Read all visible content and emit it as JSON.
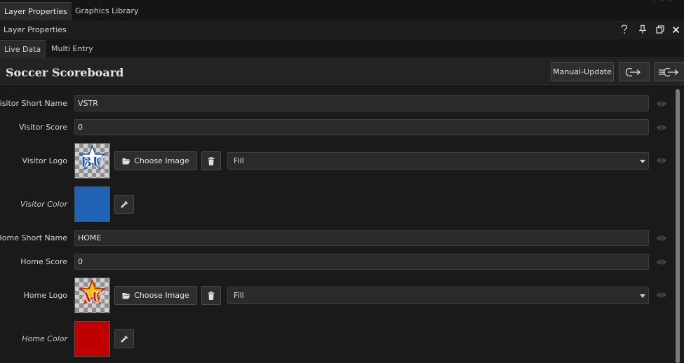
{
  "top_tabs": [
    {
      "label": "Layer Properties",
      "active": true
    },
    {
      "label": "Graphics Library",
      "active": false
    }
  ],
  "panel": {
    "title": "Layer Properties",
    "icons": [
      "help-icon",
      "pin-icon",
      "restore-window-icon",
      "close-icon"
    ]
  },
  "sub_tabs": [
    {
      "label": "Live Data",
      "active": true
    },
    {
      "label": "Multi Entry",
      "active": false
    }
  ],
  "header": {
    "title": "Soccer Scoreboard",
    "manual_update_label": "Manual-Update",
    "icons": [
      "take-out-icon",
      "fast-out-icon"
    ]
  },
  "fields": {
    "visitor_short_name": {
      "label": "Visitor Short Name",
      "value": "VSTR"
    },
    "visitor_score": {
      "label": "Visitor Score",
      "value": "0"
    },
    "visitor_logo": {
      "label": "Visitor Logo",
      "logo_text": "BU",
      "choose_label": "Choose Image",
      "fill_value": "Fill",
      "logo_colors": {
        "fill": "#1a56b0",
        "outline": "#ffffff"
      }
    },
    "visitor_color": {
      "label": "Visitor Color",
      "color": "#1e63b5"
    },
    "home_short_name": {
      "label": "Home Short Name",
      "value": "HOME"
    },
    "home_score": {
      "label": "Home Score",
      "value": "0"
    },
    "home_logo": {
      "label": "Home Logo",
      "logo_text": "AU",
      "choose_label": "Choose Image",
      "fill_value": "Fill",
      "logo_colors": {
        "fill": "#c8141a",
        "outline": "#ffffff"
      }
    },
    "home_color": {
      "label": "Home Color",
      "color": "#c00000"
    }
  },
  "colors": {
    "background": "#1a1a1a",
    "accent_text": "#d6d6d6"
  }
}
